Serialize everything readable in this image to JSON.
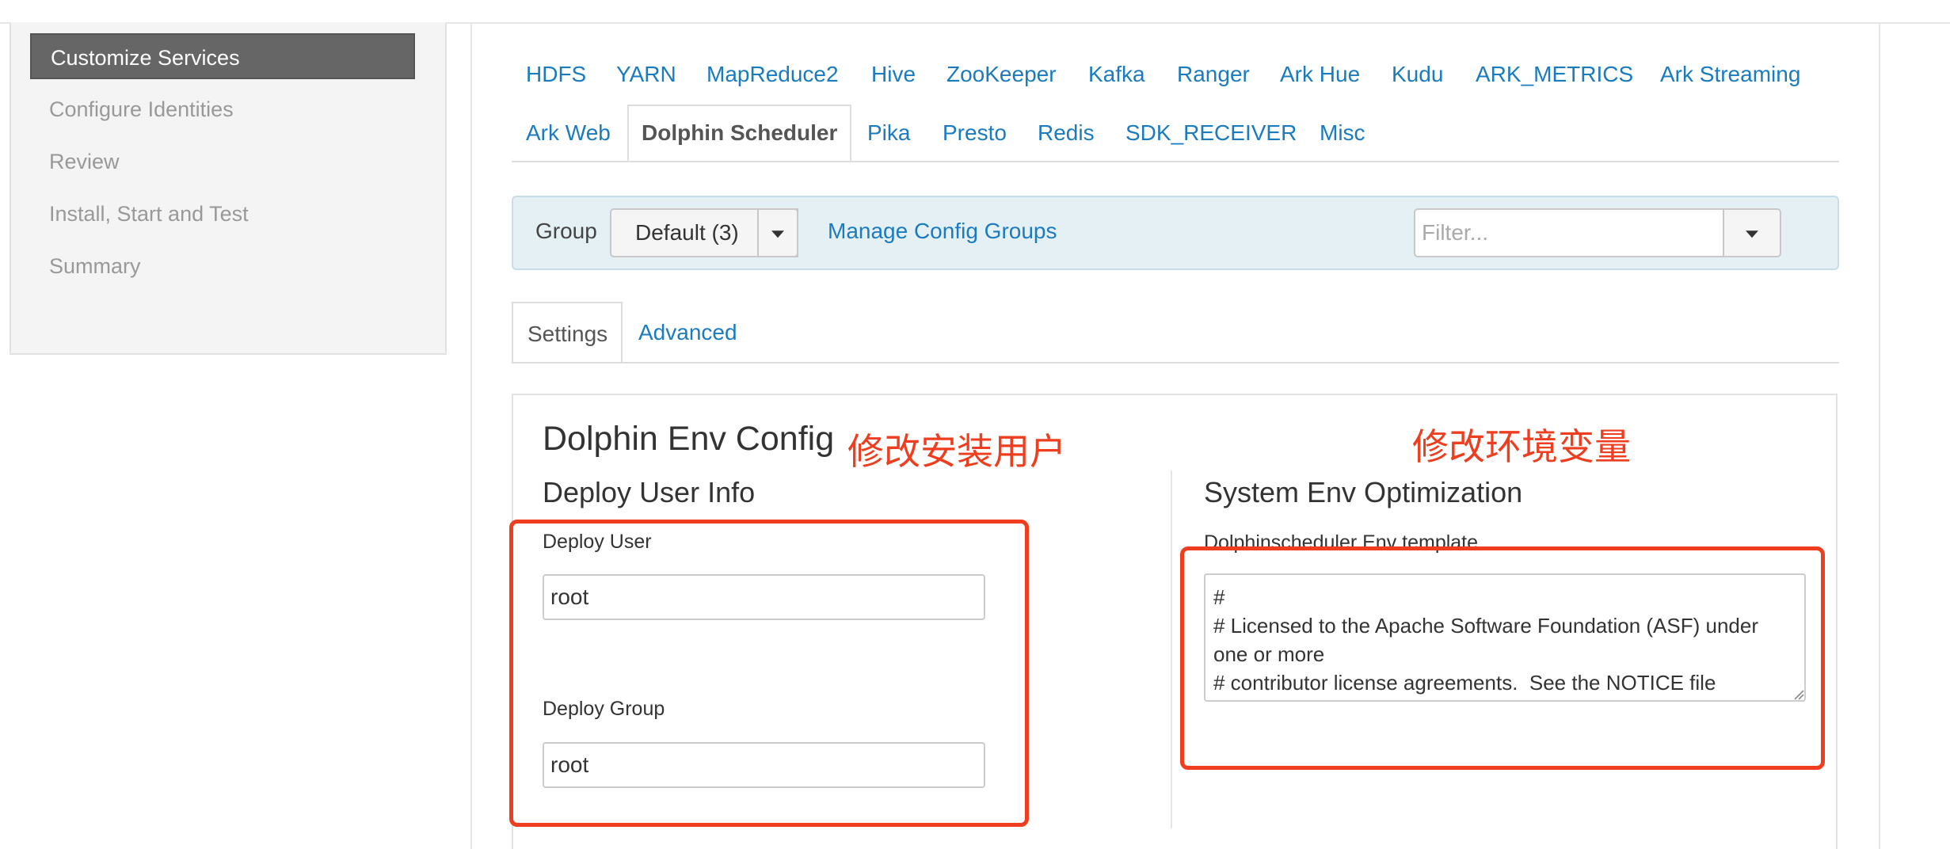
{
  "sidebar": {
    "items": [
      {
        "label": "Customize Services",
        "active": true
      },
      {
        "label": "Configure Identities",
        "active": false
      },
      {
        "label": "Review",
        "active": false
      },
      {
        "label": "Install, Start and Test",
        "active": false
      },
      {
        "label": "Summary",
        "active": false
      }
    ]
  },
  "service_tabs": {
    "row1": [
      "HDFS",
      "YARN",
      "MapReduce2",
      "Hive",
      "ZooKeeper",
      "Kafka",
      "Ranger",
      "Ark Hue",
      "Kudu",
      "ARK_METRICS",
      "Ark Streaming"
    ],
    "row2": [
      "Ark Web",
      "Dolphin Scheduler",
      "Pika",
      "Presto",
      "Redis",
      "SDK_RECEIVER",
      "Misc"
    ],
    "active": "Dolphin Scheduler"
  },
  "group_bar": {
    "label": "Group",
    "selected": "Default (3)",
    "manage_link": "Manage Config Groups",
    "filter_placeholder": "Filter..."
  },
  "sub_tabs": [
    {
      "label": "Settings",
      "active": true
    },
    {
      "label": "Advanced",
      "active": false
    }
  ],
  "config": {
    "title": "Dolphin Env Config",
    "deploy_section": {
      "title": "Deploy User Info",
      "deploy_user_label": "Deploy User",
      "deploy_user_value": "root",
      "deploy_group_label": "Deploy Group",
      "deploy_group_value": "root"
    },
    "env_section": {
      "title": "System Env Optimization",
      "template_label": "Dolphinscheduler Env template",
      "template_value": "#\n# Licensed to the Apache Software Foundation (ASF) under one or more\n# contributor license agreements.  See the NOTICE file\n# distributed with"
    }
  },
  "annotations": {
    "left_note": "修改安装用户",
    "right_note": "修改环境变量",
    "color": "#ee3e1f"
  },
  "colors": {
    "link": "#1a7bbf",
    "sidebar_active_bg": "#666666",
    "group_bar_bg": "#e5f0f5"
  }
}
